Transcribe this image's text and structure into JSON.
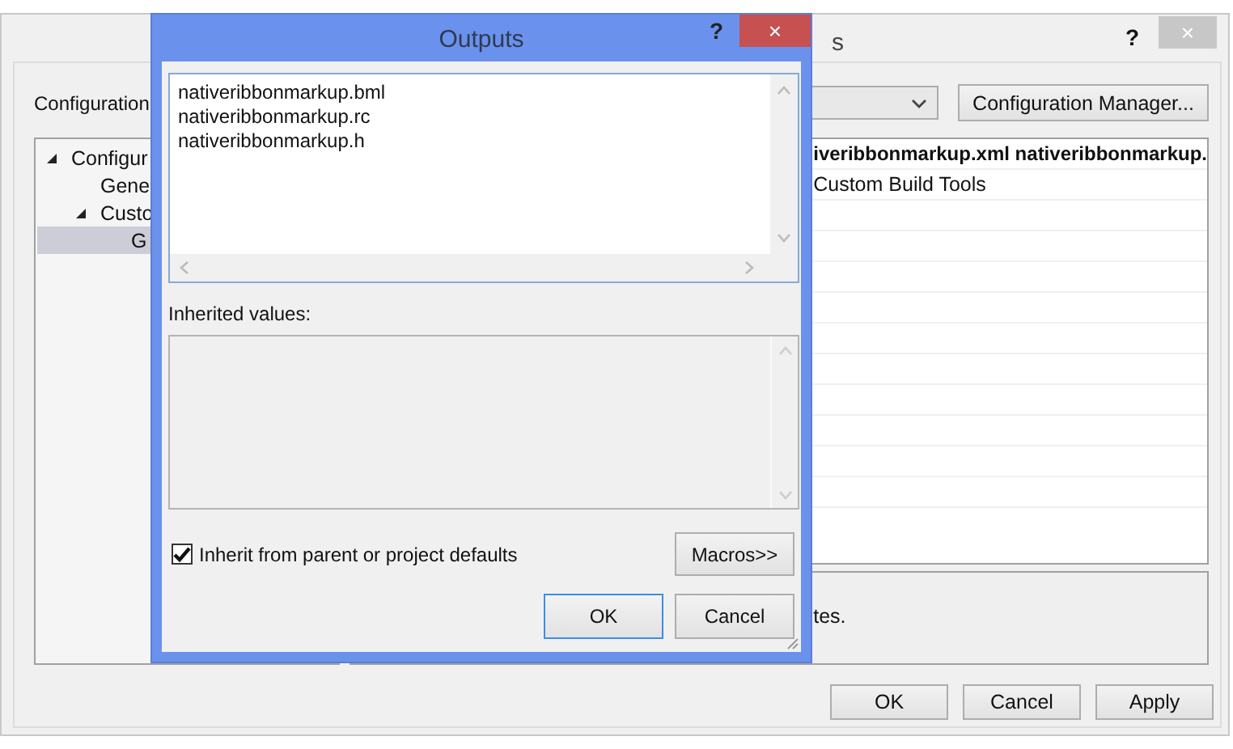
{
  "background_window": {
    "title": "s",
    "help": "?",
    "close": "×",
    "configuration_label": "Configuration",
    "config_manager_button": "Configuration Manager...",
    "tree": [
      {
        "label": "Configur",
        "expanded": true,
        "selected": false,
        "children": [
          {
            "label": "Gene",
            "selected": false
          },
          {
            "label": "Custo",
            "expanded": true,
            "selected": false,
            "children": [
              {
                "label": "G",
                "selected": true
              }
            ]
          }
        ]
      }
    ],
    "property_rows": [
      {
        "kind": "header",
        "text": "iveribbonmarkup.xml nativeribbonmarkup."
      },
      {
        "kind": "value",
        "text": "Custom Build Tools"
      }
    ],
    "description": "tes.",
    "buttons": [
      "OK",
      "Cancel",
      "Apply"
    ]
  },
  "dialog": {
    "title": "Outputs",
    "help": "?",
    "close": "×",
    "outputs": [
      "nativeribbonmarkup.bml",
      "nativeribbonmarkup.rc",
      "nativeribbonmarkup.h"
    ],
    "inherited_label": "Inherited values:",
    "inherit_checkbox": {
      "label": "Inherit from parent or project defaults",
      "checked": true
    },
    "macros_button": "Macros>>",
    "buttons": [
      "OK",
      "Cancel"
    ]
  }
}
